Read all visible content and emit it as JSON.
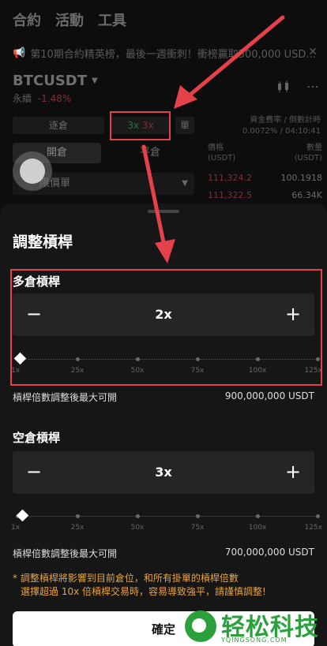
{
  "top_tabs": [
    "合約",
    "活動",
    "工具"
  ],
  "notice": {
    "text": "第10期合約精英榜，最後一週衝刺！衝榜贏取500,000 USD..."
  },
  "symbol": {
    "name": "BTCUSDT",
    "type": "永續",
    "change": "-1.48%"
  },
  "controls": {
    "margin_mode": "逐倉",
    "leverage_long": "3x",
    "leverage_short": "3x",
    "unit": "單",
    "open_tab": "開倉",
    "close_tab": "平倉",
    "order_type": "限價單"
  },
  "funding": {
    "label": "資金費率 / 倒數計時",
    "value": "0.0072% / 04:10:41"
  },
  "orderbook": {
    "price_header": "價格",
    "price_unit": "(USDT)",
    "qty_header": "數量",
    "qty_unit": "(USDT)",
    "rows": [
      {
        "price": "111,324.2",
        "qty": "100.1918"
      },
      {
        "price": "111,322.5",
        "qty": "66.34K"
      }
    ]
  },
  "sheet": {
    "title": "調整槓桿",
    "long": {
      "label": "多倉槓桿",
      "value": "2x",
      "level": 2,
      "max_label": "槓桿倍數調整後最大可開",
      "max_value": "900,000,000 USDT"
    },
    "short": {
      "label": "空倉槓桿",
      "value": "3x",
      "level": 3,
      "max_label": "槓桿倍數調整後最大可開",
      "max_value": "700,000,000 USDT"
    },
    "minus": "−",
    "plus": "+",
    "ticks": [
      "1x",
      "25x",
      "50x",
      "75x",
      "100x",
      "125x"
    ],
    "warning_line1": "* 調整槓桿將影響到目前倉位，和所有掛單的槓桿倍數",
    "warning_line2": "選擇超過 10x 倍槓桿交易時，容易導致強平，請謹慎調整!",
    "confirm": "確定"
  },
  "watermark": {
    "text": "轻松科技",
    "url": "YQINGSONG.COM"
  },
  "colors": {
    "annotation": "#e5414a",
    "warning": "#e9a43a",
    "watermark": "#2aa13c"
  }
}
